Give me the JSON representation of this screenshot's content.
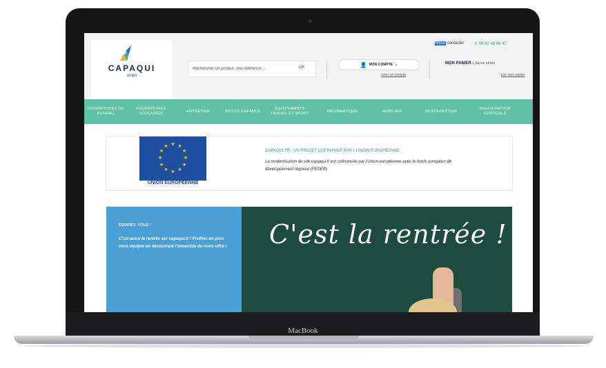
{
  "device": {
    "brand": "MacBook"
  },
  "logo": {
    "name": "CAPAQUI",
    "sub": "ampo"
  },
  "search": {
    "placeholder": "Rechercher un produit, une référence ...",
    "ok_label": "OK"
  },
  "account": {
    "button_label": "MON COMPTE",
    "create_link": "créer un compte"
  },
  "contact": {
    "prefix": "Nous",
    "label": " contacter",
    "phone": "09 82 48 66 47"
  },
  "cart": {
    "title": "MON PANIER :",
    "count": "Aucun article",
    "link": "voir mon panier"
  },
  "nav": {
    "items": [
      {
        "label": "FOURNITURES DE BUREAU"
      },
      {
        "label": "FOURNITURES SCOLAIRES"
      },
      {
        "label": "ENTRETIEN"
      },
      {
        "label": "PETITE ENFANCE"
      },
      {
        "label": "ÉQUIPEMENTS TRAVAIL ET SPORT"
      },
      {
        "label": "INFORMATIQUE"
      },
      {
        "label": "MOBILIER"
      },
      {
        "label": "RESTAURATION"
      },
      {
        "label": "SIGNALISATION VERTICALE"
      }
    ]
  },
  "eu": {
    "flag_caption": "UNION EUROPÉENNE",
    "title": "CAPAQUI.FR : UN PROJET COFINANCÉ PAR L'UNION EUROPÉENNE",
    "text": "La modernisation du site capaqui.fr est cofinancée par l'Union européenne avec le fonds européen de développement régional (FEDER)"
  },
  "promo": {
    "title": "ÉQUIPEZ- VOUS !",
    "text": "C'est aussi la rentrée sur capaqui.fr ! Profitez-en pour vous équiper en découvrant l'ensemble de notre offre !",
    "chalk_text": "C'est la rentrée !"
  },
  "colors": {
    "nav": "#5fc2a5",
    "accent": "#2fa28f",
    "promo_blue": "#4a9fd4",
    "board": "#1d4b3e",
    "eu_blue": "#1f4fa0"
  }
}
